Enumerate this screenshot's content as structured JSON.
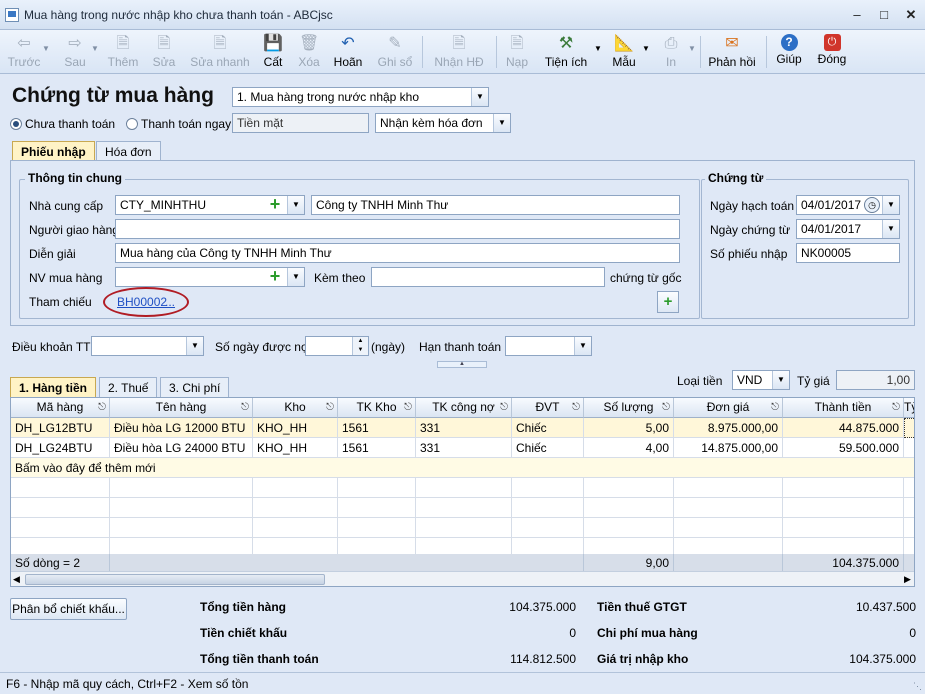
{
  "window": {
    "title": "Mua hàng trong nước nhập kho chưa thanh toán - ABCjsc"
  },
  "toolbar": {
    "items": [
      {
        "label": "Trước",
        "icon": "arrow-left-icon"
      },
      {
        "label": "Sau",
        "icon": "arrow-right-icon"
      },
      {
        "label": "Thêm",
        "icon": "add-doc-icon"
      },
      {
        "label": "Sửa",
        "icon": "edit-doc-icon"
      },
      {
        "label": "Sửa nhanh",
        "icon": "quick-edit-icon"
      },
      {
        "label": "Cất",
        "icon": "save-icon"
      },
      {
        "label": "Xóa",
        "icon": "delete-icon"
      },
      {
        "label": "Hoãn",
        "icon": "undo-icon"
      },
      {
        "label": "Ghi sổ",
        "icon": "pencil-icon"
      },
      {
        "label": "Nhận HĐ",
        "icon": "invoice-icon"
      },
      {
        "label": "Nạp",
        "icon": "reload-icon"
      },
      {
        "label": "Tiện ích",
        "icon": "tools-icon"
      },
      {
        "label": "Mẫu",
        "icon": "template-icon"
      },
      {
        "label": "In",
        "icon": "printer-icon"
      },
      {
        "label": "Phản hồi",
        "icon": "mail-icon"
      },
      {
        "label": "Giúp",
        "icon": "help-icon"
      },
      {
        "label": "Đóng",
        "icon": "close-icon"
      }
    ]
  },
  "header": {
    "title": "Chứng từ mua hàng",
    "type_value": "1. Mua hàng trong nước nhập kho",
    "radio_unpaid": "Chưa thanh toán",
    "radio_paid": "Thanh toán ngay",
    "payment_method": "Tiền mặt",
    "invoice_option": "Nhận kèm hóa đơn"
  },
  "tabs": {
    "receipt": "Phiếu nhập",
    "invoice": "Hóa đơn"
  },
  "general": {
    "title": "Thông tin chung",
    "supplier_label": "Nhà cung cấp",
    "supplier_code": "CTY_MINHTHU",
    "supplier_name": "Công ty TNHH Minh Thư",
    "deliverer_label": "Người giao hàng",
    "deliverer_value": "",
    "description_label": "Diễn giải",
    "description_value": "Mua hàng của Công ty TNHH Minh Thư",
    "buyer_label": "NV mua hàng",
    "buyer_value": "",
    "attach_label": "Kèm theo",
    "attach_value": "",
    "attach_suffix": "chứng từ gốc",
    "reference_label": "Tham chiếu",
    "reference_value": "BH00002",
    "reference_more": "..."
  },
  "voucher": {
    "title": "Chứng từ",
    "posting_date_label": "Ngày hạch toán",
    "posting_date": "04/01/2017",
    "voucher_date_label": "Ngày chứng từ",
    "voucher_date": "04/01/2017",
    "receipt_no_label": "Số phiếu nhập",
    "receipt_no": "NK00005"
  },
  "terms": {
    "payment_terms_label": "Điều khoản TT",
    "credit_days_label": "Số ngày được nợ",
    "credit_days_unit": "(ngày)",
    "due_date_label": "Hạn thanh toán"
  },
  "detail_tabs": {
    "goods": "1. Hàng tiền",
    "tax": "2. Thuế",
    "cost": "3. Chi phí"
  },
  "currency": {
    "label": "Loại tiền",
    "value": "VND",
    "rate_label": "Tỷ giá",
    "rate_value": "1,00"
  },
  "grid": {
    "columns": [
      "Mã hàng",
      "Tên hàng",
      "Kho",
      "TK Kho",
      "TK công nợ",
      "ĐVT",
      "Số lượng",
      "Đơn giá",
      "Thành tiền",
      "Tỷ"
    ],
    "rows": [
      [
        "DH_LG12BTU",
        "Điều hòa LG 12000 BTU",
        "KHO_HH",
        "1561",
        "331",
        "Chiếc",
        "5,00",
        "8.975.000,00",
        "44.875.000"
      ],
      [
        "DH_LG24BTU",
        "Điều hòa LG 24000 BTU",
        "KHO_HH",
        "1561",
        "331",
        "Chiếc",
        "4,00",
        "14.875.000,00",
        "59.500.000"
      ]
    ],
    "add_row_text": "Bấm vào đây để thêm mới",
    "footer_count": "Số dòng = 2",
    "footer_qty": "9,00",
    "footer_amount": "104.375.000"
  },
  "summary": {
    "allocate_button": "Phân bổ chiết khấu...",
    "total_goods_label": "Tổng tiền hàng",
    "total_goods": "104.375.000",
    "discount_label": "Tiền chiết khấu",
    "discount": "0",
    "total_payment_label": "Tổng tiền thanh toán",
    "total_payment": "114.812.500",
    "vat_label": "Tiền thuế GTGT",
    "vat": "10.437.500",
    "purchase_cost_label": "Chi phí mua hàng",
    "purchase_cost": "0",
    "inventory_value_label": "Giá trị nhập kho",
    "inventory_value": "104.375.000"
  },
  "status": {
    "text": "F6 - Nhập mã quy cách, Ctrl+F2 - Xem số tồn"
  }
}
